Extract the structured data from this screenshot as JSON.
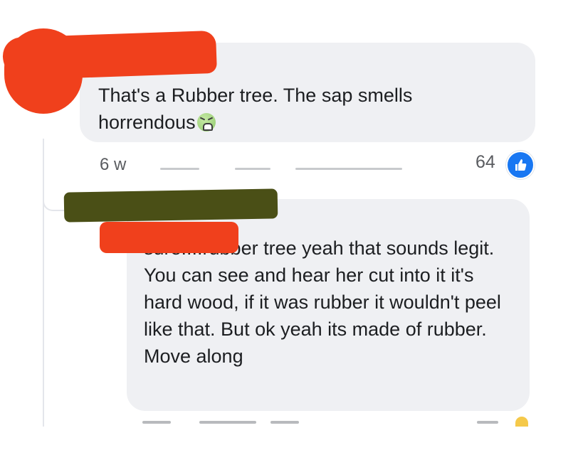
{
  "comment_1": {
    "text": "That's a Rubber tree. The sap smells horrendous",
    "emoji": "nauseated-face-icon",
    "time": "6 w",
    "reaction_count": "64",
    "reaction_icon": "like-icon"
  },
  "comment_2": {
    "text": "sure....rubber tree yeah that sounds legit. You can see and hear her cut into it it's hard wood, if it was rubber it wouldn't peel like that. But ok yeah its made of rubber. Move along"
  },
  "colors": {
    "bubble": "#eff0f3",
    "like_blue": "#1877f2",
    "redaction_orange": "#f0401c",
    "redaction_olive": "#4a4f16"
  }
}
